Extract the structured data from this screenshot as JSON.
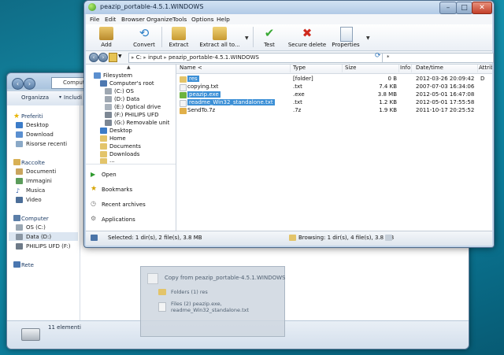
{
  "explorer": {
    "address": "Compute",
    "toolbar": {
      "organize": "Organizza",
      "include": "Includi n"
    },
    "favorites": {
      "header": "Preferiti",
      "items": [
        "Desktop",
        "Download",
        "Risorse recenti"
      ]
    },
    "libraries": {
      "header": "Raccolte",
      "items": [
        "Documenti",
        "Immagini",
        "Musica",
        "Video"
      ]
    },
    "computer": {
      "header": "Computer",
      "items": [
        "OS (C:)",
        "Data (D:)",
        "PHILIPS UFD (F:)"
      ]
    },
    "network": "Rete",
    "status": "11 elementi"
  },
  "drag": {
    "title": "Copy from peazip_portable-4.5.1.WINDOWS",
    "folders": "Folders (1) res",
    "files_line1": "Files (2) peazip.exe,",
    "files_line2": "readme_Win32_standalone.txt"
  },
  "peazip": {
    "title": "peazip_portable-4.5.1.WINDOWS",
    "menu": [
      "File",
      "Edit",
      "Browser",
      "Organize",
      "Tools",
      "Options",
      "Help"
    ],
    "toolbar": {
      "add": "Add",
      "convert": "Convert",
      "extract": "Extract",
      "extract_all": "Extract all to...",
      "test": "Test",
      "secure_delete": "Secure delete",
      "properties": "Properties"
    },
    "path": {
      "root": "C:",
      "seg1": "input",
      "seg2": "peazip_portable-4.5.1.WINDOWS"
    },
    "filter": "*",
    "tree": {
      "filesystem": "Filesystem",
      "computer_root": "Computer's root",
      "drives": [
        "(C:) OS",
        "(D:) Data",
        "(E:) Optical drive",
        "(F:) PHILIPS UFD",
        "(G:) Removable unit"
      ],
      "folders": [
        "Desktop",
        "Home",
        "Documents",
        "Downloads",
        "..."
      ]
    },
    "side_links": {
      "open": "Open",
      "bookmarks": "Bookmarks",
      "recent": "Recent archives",
      "apps": "Applications"
    },
    "columns": [
      "Name <",
      "Type",
      "Size",
      "Info",
      "Date/time",
      "Attrib"
    ],
    "files": [
      {
        "name": "res",
        "type": "[folder]",
        "size": "0 B",
        "date": "2012-03-26 20:09:42",
        "attr": "D",
        "selected": true
      },
      {
        "name": "copying.txt",
        "type": ".txt",
        "size": "7.4 KB",
        "date": "2007-07-03 16:34:06",
        "attr": "",
        "selected": false
      },
      {
        "name": "peazip.exe",
        "type": ".exe",
        "size": "3.8 MB",
        "date": "2012-05-01 16:47:08",
        "attr": "",
        "selected": true
      },
      {
        "name": "readme_Win32_standalone.txt",
        "type": ".txt",
        "size": "1.2 KB",
        "date": "2012-05-01 17:55:58",
        "attr": "",
        "selected": true
      },
      {
        "name": "SendTo.7z",
        "type": ".7z",
        "size": "1.9 KB",
        "date": "2011-10-17 20:25:52",
        "attr": "",
        "selected": false
      }
    ],
    "status_left": "Selected: 1 dir(s), 2 file(s), 3.8 MB",
    "status_right": "Browsing: 1 dir(s), 4 file(s), 3.8 MB"
  }
}
